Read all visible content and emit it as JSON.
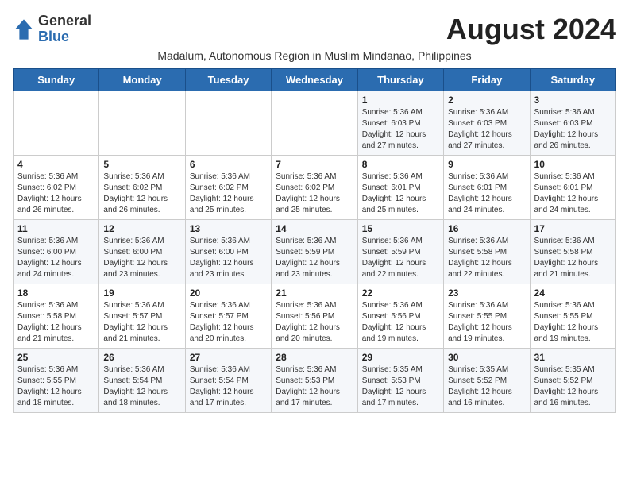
{
  "header": {
    "logo_line1": "General",
    "logo_line2": "Blue",
    "month_title": "August 2024",
    "subtitle": "Madalum, Autonomous Region in Muslim Mindanao, Philippines"
  },
  "days_of_week": [
    "Sunday",
    "Monday",
    "Tuesday",
    "Wednesday",
    "Thursday",
    "Friday",
    "Saturday"
  ],
  "weeks": [
    [
      {
        "day": "",
        "info": ""
      },
      {
        "day": "",
        "info": ""
      },
      {
        "day": "",
        "info": ""
      },
      {
        "day": "",
        "info": ""
      },
      {
        "day": "1",
        "info": "Sunrise: 5:36 AM\nSunset: 6:03 PM\nDaylight: 12 hours and 27 minutes."
      },
      {
        "day": "2",
        "info": "Sunrise: 5:36 AM\nSunset: 6:03 PM\nDaylight: 12 hours and 27 minutes."
      },
      {
        "day": "3",
        "info": "Sunrise: 5:36 AM\nSunset: 6:03 PM\nDaylight: 12 hours and 26 minutes."
      }
    ],
    [
      {
        "day": "4",
        "info": "Sunrise: 5:36 AM\nSunset: 6:02 PM\nDaylight: 12 hours and 26 minutes."
      },
      {
        "day": "5",
        "info": "Sunrise: 5:36 AM\nSunset: 6:02 PM\nDaylight: 12 hours and 26 minutes."
      },
      {
        "day": "6",
        "info": "Sunrise: 5:36 AM\nSunset: 6:02 PM\nDaylight: 12 hours and 25 minutes."
      },
      {
        "day": "7",
        "info": "Sunrise: 5:36 AM\nSunset: 6:02 PM\nDaylight: 12 hours and 25 minutes."
      },
      {
        "day": "8",
        "info": "Sunrise: 5:36 AM\nSunset: 6:01 PM\nDaylight: 12 hours and 25 minutes."
      },
      {
        "day": "9",
        "info": "Sunrise: 5:36 AM\nSunset: 6:01 PM\nDaylight: 12 hours and 24 minutes."
      },
      {
        "day": "10",
        "info": "Sunrise: 5:36 AM\nSunset: 6:01 PM\nDaylight: 12 hours and 24 minutes."
      }
    ],
    [
      {
        "day": "11",
        "info": "Sunrise: 5:36 AM\nSunset: 6:00 PM\nDaylight: 12 hours and 24 minutes."
      },
      {
        "day": "12",
        "info": "Sunrise: 5:36 AM\nSunset: 6:00 PM\nDaylight: 12 hours and 23 minutes."
      },
      {
        "day": "13",
        "info": "Sunrise: 5:36 AM\nSunset: 6:00 PM\nDaylight: 12 hours and 23 minutes."
      },
      {
        "day": "14",
        "info": "Sunrise: 5:36 AM\nSunset: 5:59 PM\nDaylight: 12 hours and 23 minutes."
      },
      {
        "day": "15",
        "info": "Sunrise: 5:36 AM\nSunset: 5:59 PM\nDaylight: 12 hours and 22 minutes."
      },
      {
        "day": "16",
        "info": "Sunrise: 5:36 AM\nSunset: 5:58 PM\nDaylight: 12 hours and 22 minutes."
      },
      {
        "day": "17",
        "info": "Sunrise: 5:36 AM\nSunset: 5:58 PM\nDaylight: 12 hours and 21 minutes."
      }
    ],
    [
      {
        "day": "18",
        "info": "Sunrise: 5:36 AM\nSunset: 5:58 PM\nDaylight: 12 hours and 21 minutes."
      },
      {
        "day": "19",
        "info": "Sunrise: 5:36 AM\nSunset: 5:57 PM\nDaylight: 12 hours and 21 minutes."
      },
      {
        "day": "20",
        "info": "Sunrise: 5:36 AM\nSunset: 5:57 PM\nDaylight: 12 hours and 20 minutes."
      },
      {
        "day": "21",
        "info": "Sunrise: 5:36 AM\nSunset: 5:56 PM\nDaylight: 12 hours and 20 minutes."
      },
      {
        "day": "22",
        "info": "Sunrise: 5:36 AM\nSunset: 5:56 PM\nDaylight: 12 hours and 19 minutes."
      },
      {
        "day": "23",
        "info": "Sunrise: 5:36 AM\nSunset: 5:55 PM\nDaylight: 12 hours and 19 minutes."
      },
      {
        "day": "24",
        "info": "Sunrise: 5:36 AM\nSunset: 5:55 PM\nDaylight: 12 hours and 19 minutes."
      }
    ],
    [
      {
        "day": "25",
        "info": "Sunrise: 5:36 AM\nSunset: 5:55 PM\nDaylight: 12 hours and 18 minutes."
      },
      {
        "day": "26",
        "info": "Sunrise: 5:36 AM\nSunset: 5:54 PM\nDaylight: 12 hours and 18 minutes."
      },
      {
        "day": "27",
        "info": "Sunrise: 5:36 AM\nSunset: 5:54 PM\nDaylight: 12 hours and 17 minutes."
      },
      {
        "day": "28",
        "info": "Sunrise: 5:36 AM\nSunset: 5:53 PM\nDaylight: 12 hours and 17 minutes."
      },
      {
        "day": "29",
        "info": "Sunrise: 5:35 AM\nSunset: 5:53 PM\nDaylight: 12 hours and 17 minutes."
      },
      {
        "day": "30",
        "info": "Sunrise: 5:35 AM\nSunset: 5:52 PM\nDaylight: 12 hours and 16 minutes."
      },
      {
        "day": "31",
        "info": "Sunrise: 5:35 AM\nSunset: 5:52 PM\nDaylight: 12 hours and 16 minutes."
      }
    ]
  ]
}
